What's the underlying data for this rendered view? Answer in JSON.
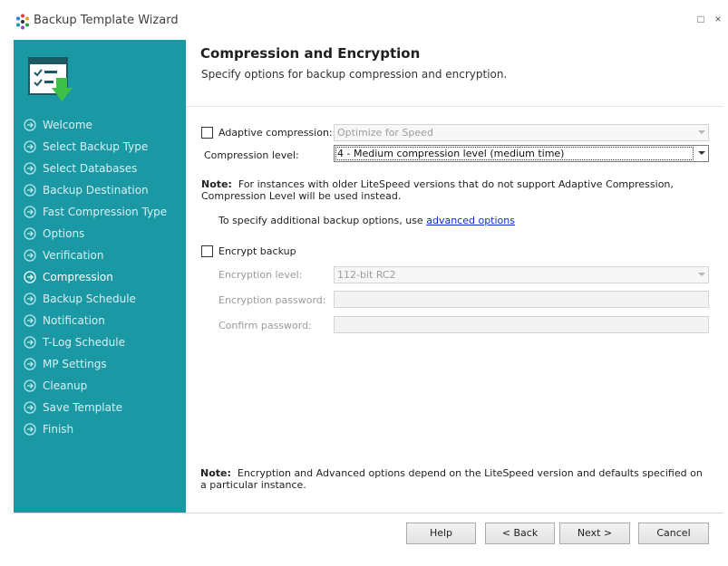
{
  "window": {
    "title": "Backup Template Wizard",
    "maximize_glyph": "□",
    "close_glyph": "×"
  },
  "sidebar": {
    "items": [
      {
        "label": "Welcome",
        "active": false
      },
      {
        "label": "Select Backup Type",
        "active": false
      },
      {
        "label": "Select Databases",
        "active": false
      },
      {
        "label": "Backup Destination",
        "active": false
      },
      {
        "label": "Fast Compression Type",
        "active": false
      },
      {
        "label": "Options",
        "active": false
      },
      {
        "label": "Verification",
        "active": false
      },
      {
        "label": "Compression",
        "active": true
      },
      {
        "label": "Backup Schedule",
        "active": false
      },
      {
        "label": "Notification",
        "active": false
      },
      {
        "label": "T-Log Schedule",
        "active": false
      },
      {
        "label": "MP Settings",
        "active": false
      },
      {
        "label": "Cleanup",
        "active": false
      },
      {
        "label": "Save Template",
        "active": false
      },
      {
        "label": "Finish",
        "active": false
      }
    ]
  },
  "page": {
    "title": "Compression and Encryption",
    "subtitle": "Specify options for backup compression and encryption."
  },
  "compression": {
    "adaptive_label": "Adaptive compression:",
    "adaptive_checked": false,
    "adaptive_value": "Optimize for Speed",
    "level_label": "Compression level:",
    "level_value": "4 - Medium compression level (medium time)"
  },
  "note1": {
    "prefix": "Note:",
    "text": "For instances with older LiteSpeed versions that do not support Adaptive Compression, Compression Level will be used instead."
  },
  "advanced": {
    "text": "To specify additional backup options, use",
    "link": "advanced options"
  },
  "encryption": {
    "encrypt_label": "Encrypt backup",
    "encrypt_checked": false,
    "level_label": "Encryption level:",
    "level_value": "112-bit RC2",
    "password_label": "Encryption password:",
    "confirm_label": "Confirm password:"
  },
  "note2": {
    "prefix": "Note:",
    "text": "Encryption and Advanced options depend on the LiteSpeed version and defaults specified on a particular instance."
  },
  "footer": {
    "help": "Help",
    "back": "< Back",
    "next": "Next >",
    "cancel": "Cancel"
  },
  "colors": {
    "sidebar_bg": "#1a98a3",
    "accent_green": "#3cc04a",
    "link": "#0a2fd1"
  }
}
